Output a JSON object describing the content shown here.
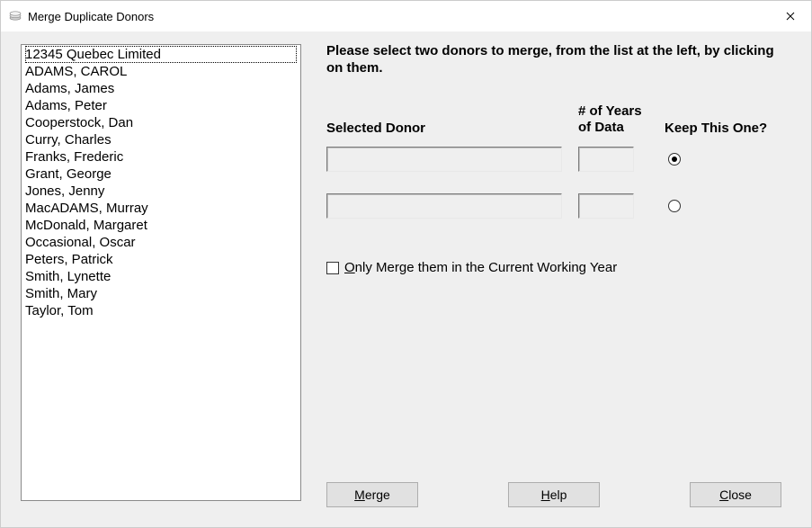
{
  "window": {
    "title": "Merge Duplicate Donors"
  },
  "listbox": {
    "items": [
      "12345 Quebec Limited",
      "ADAMS, CAROL",
      "Adams, James",
      "Adams, Peter",
      "Cooperstock, Dan",
      "Curry, Charles",
      "Franks, Frederic",
      "Grant, George",
      "Jones, Jenny",
      "MacADAMS, Murray",
      "McDonald, Margaret",
      "Occasional, Oscar",
      "Peters, Patrick",
      "Smith, Lynette",
      "Smith, Mary",
      "Taylor, Tom"
    ],
    "focused_index": 0
  },
  "instruction": "Please select two donors to merge, from the list at the left, by clicking on them.",
  "headers": {
    "selected_donor": "Selected Donor",
    "years_line1": "# of Years",
    "years_line2": "of Data",
    "keep": "Keep This One?"
  },
  "rows": [
    {
      "donor": "",
      "years": "",
      "keep_selected": true
    },
    {
      "donor": "",
      "years": "",
      "keep_selected": false
    }
  ],
  "checkbox": {
    "checked": false,
    "label_pre_accel": "",
    "label_accel": "O",
    "label_post_accel": "nly Merge them in the Current Working Year"
  },
  "buttons": {
    "merge_accel": "M",
    "merge_rest": "erge",
    "help_accel": "H",
    "help_rest": "elp",
    "close_accel": "C",
    "close_rest": "lose"
  }
}
